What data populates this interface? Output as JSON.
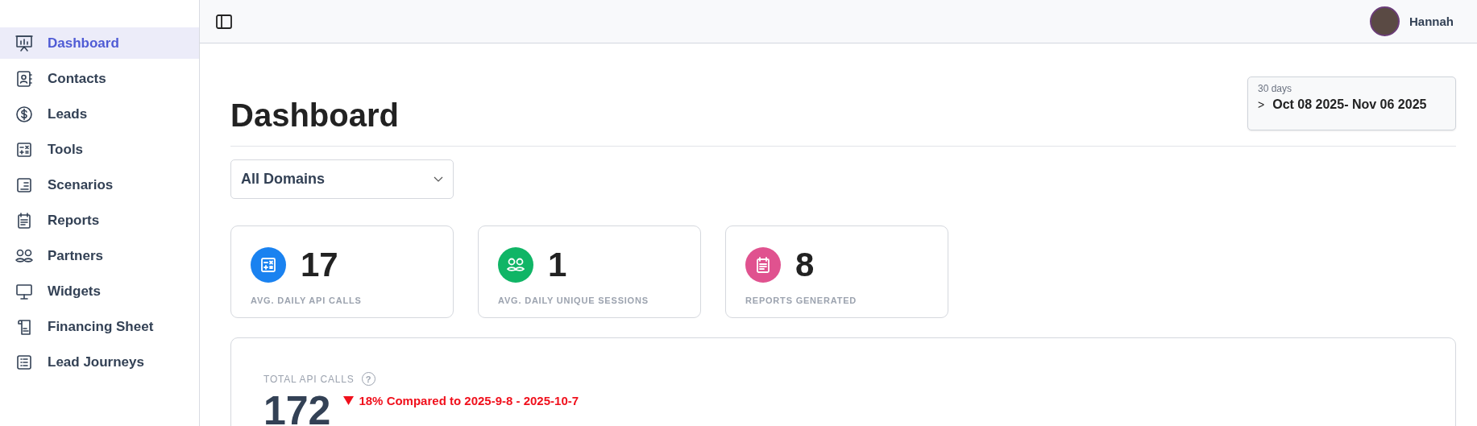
{
  "sidebar": {
    "items": [
      {
        "label": "Dashboard",
        "selected": true
      },
      {
        "label": "Contacts",
        "selected": false
      },
      {
        "label": "Leads",
        "selected": false
      },
      {
        "label": "Tools",
        "selected": false
      },
      {
        "label": "Scenarios",
        "selected": false
      },
      {
        "label": "Reports",
        "selected": false
      },
      {
        "label": "Partners",
        "selected": false
      },
      {
        "label": "Widgets",
        "selected": false
      },
      {
        "label": "Financing Sheet",
        "selected": false
      },
      {
        "label": "Lead Journeys",
        "selected": false
      }
    ]
  },
  "topbar": {
    "user": "Hannah"
  },
  "page": {
    "title": "Dashboard",
    "date_range": {
      "caption": "30 days",
      "chevron": ">",
      "range": "Oct 08 2025- Nov 06 2025"
    },
    "domain_select": {
      "value": "All Domains"
    }
  },
  "stats": [
    {
      "value": "17",
      "label": "AVG. DAILY API CALLS",
      "color": "#1a82f0"
    },
    {
      "value": "1",
      "label": "AVG. DAILY UNIQUE SESSIONS",
      "color": "#10b566"
    },
    {
      "value": "8",
      "label": "REPORTS GENERATED",
      "color": "#e0528f"
    }
  ],
  "total": {
    "label": "TOTAL API CALLS",
    "help": "?",
    "value": "172",
    "trend": "18% Compared to 2025-9-8 - 2025-10-7"
  }
}
